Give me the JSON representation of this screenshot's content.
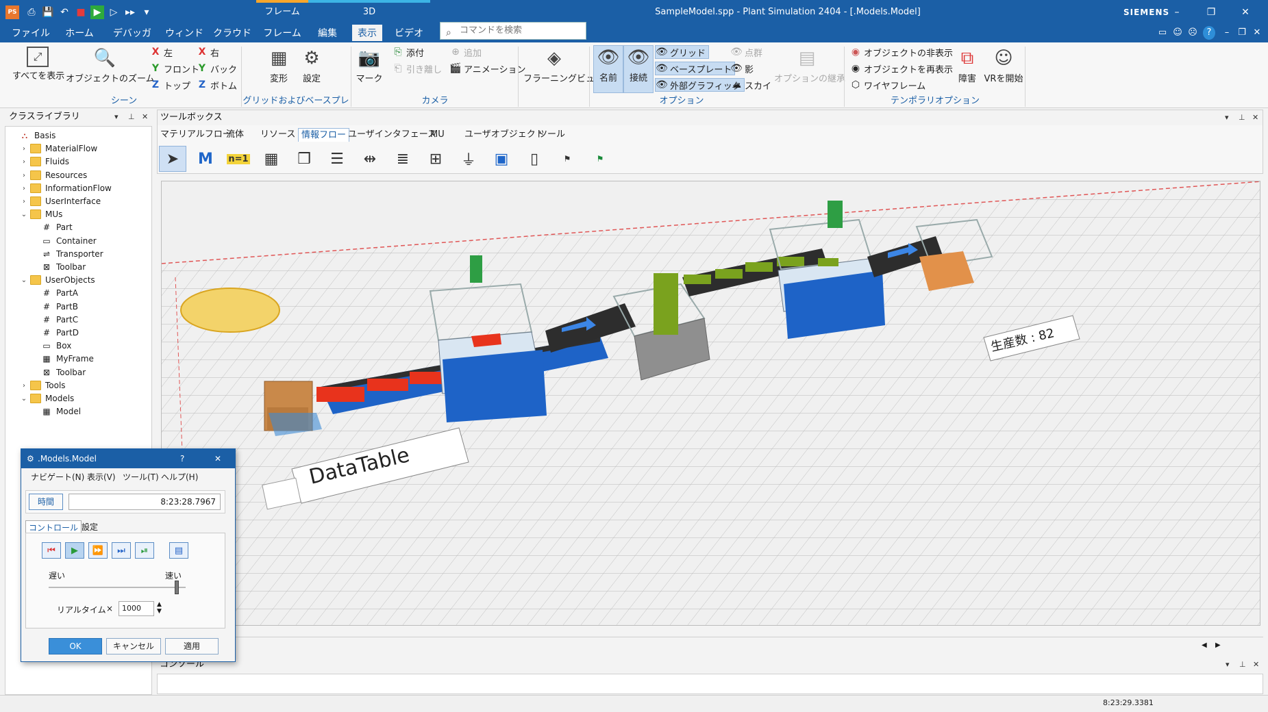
{
  "window": {
    "title": "SampleModel.spp - Plant Simulation 2404 - [.Models.Model]",
    "brand": "SIEMENS",
    "context_tabs": [
      "フレーム",
      "3D"
    ],
    "controls": [
      "–",
      "❐",
      "✕"
    ]
  },
  "quick_access": [
    "PS",
    "⎙",
    "💾",
    "↶",
    "■",
    "▶",
    "▷",
    "▸▸",
    "▾"
  ],
  "menu_tabs": [
    "ファイル",
    "ホーム",
    "デバッガ",
    "ウィンドウ",
    "クラウド",
    "フレーム",
    "編集",
    "表示",
    "ビデオ"
  ],
  "active_menu": "表示",
  "search": {
    "placeholder": "コマンドを検索"
  },
  "ribbon": {
    "scene": {
      "show_all": "すべてを表示",
      "zoom_object": "オブジェクトのズーム",
      "left": "左",
      "right": "右",
      "front": "フロント",
      "back": "バック",
      "top": "トップ",
      "bottom": "ボトム",
      "group": "シーン"
    },
    "grid": {
      "transform": "変形",
      "settings": "設定",
      "group": "グリッドおよびベースプレート"
    },
    "camera": {
      "mark": "マーク",
      "attach": "添付",
      "detach": "引き離し",
      "add": "追加",
      "animation": "アニメーション",
      "group": "カメラ"
    },
    "flyview": "フラーニングビュー",
    "options": {
      "name": "名前",
      "connect": "接続",
      "grid": "グリッド",
      "baseplate": "ベースプレート",
      "ext_graphics": "外部グラフィック",
      "points": "点群",
      "shadow": "影",
      "sky": "スカイ",
      "inherit": "オプションの継承",
      "group": "オプション"
    },
    "temp_options": {
      "hide": "オブジェクトの非表示",
      "reshow": "オブジェクトを再表示",
      "wireframe": "ワイヤフレーム",
      "fault": "障害",
      "vr": "VRを開始",
      "group": "テンポラリオプション"
    }
  },
  "class_library": {
    "title": "クラスライブラリ",
    "items": [
      {
        "label": "Basis",
        "level": 0,
        "exp": "",
        "icon": "basis"
      },
      {
        "label": "MaterialFlow",
        "level": 1,
        "exp": "›",
        "icon": "folder"
      },
      {
        "label": "Fluids",
        "level": 1,
        "exp": "›",
        "icon": "folder"
      },
      {
        "label": "Resources",
        "level": 1,
        "exp": "›",
        "icon": "folder"
      },
      {
        "label": "InformationFlow",
        "level": 1,
        "exp": "›",
        "icon": "folder"
      },
      {
        "label": "UserInterface",
        "level": 1,
        "exp": "›",
        "icon": "folder"
      },
      {
        "label": "MUs",
        "level": 1,
        "exp": "⌄",
        "icon": "folder"
      },
      {
        "label": "Part",
        "level": 2,
        "exp": "",
        "icon": "part"
      },
      {
        "label": "Container",
        "level": 2,
        "exp": "",
        "icon": "container"
      },
      {
        "label": "Transporter",
        "level": 2,
        "exp": "",
        "icon": "transporter"
      },
      {
        "label": "Toolbar",
        "level": 2,
        "exp": "",
        "icon": "toolbar"
      },
      {
        "label": "UserObjects",
        "level": 1,
        "exp": "⌄",
        "icon": "folder"
      },
      {
        "label": "PartA",
        "level": 2,
        "exp": "",
        "icon": "part"
      },
      {
        "label": "PartB",
        "level": 2,
        "exp": "",
        "icon": "part"
      },
      {
        "label": "PartC",
        "level": 2,
        "exp": "",
        "icon": "part"
      },
      {
        "label": "PartD",
        "level": 2,
        "exp": "",
        "icon": "part"
      },
      {
        "label": "Box",
        "level": 2,
        "exp": "",
        "icon": "container"
      },
      {
        "label": "MyFrame",
        "level": 2,
        "exp": "",
        "icon": "frame"
      },
      {
        "label": "Toolbar",
        "level": 2,
        "exp": "",
        "icon": "toolbar"
      },
      {
        "label": "Tools",
        "level": 1,
        "exp": "›",
        "icon": "folder"
      },
      {
        "label": "Models",
        "level": 1,
        "exp": "⌄",
        "icon": "folder"
      },
      {
        "label": "Model",
        "level": 2,
        "exp": "",
        "icon": "frame"
      }
    ]
  },
  "toolbox": {
    "title": "ツールボックス",
    "tabs": [
      "マテリアルフロー",
      "流体",
      "リソース",
      "情報フロー",
      "ユーザインタフェース",
      "MU",
      "ユーザオブジェクト",
      "ツール"
    ],
    "active_tab": "情報フロー",
    "tools": [
      "pointer-icon",
      "method-icon",
      "variable-icon",
      "table-icon",
      "stack-icon",
      "queue-icon",
      "interface-icon",
      "list-icon",
      "chart-icon",
      "generator-icon",
      "matrix-icon",
      "file-link-icon",
      "pts-icon",
      "xml-pts-icon"
    ]
  },
  "scene": {
    "datatable_label": "DataTable",
    "production_label": "生産数 : 82"
  },
  "console": {
    "title": "コンソール"
  },
  "status": {
    "time": "8:23:29.3381"
  },
  "event_controller": {
    "title": ".Models.Model",
    "help": "?",
    "close": "✕",
    "menu": [
      "ナビゲート(N)",
      "表示(V)",
      "ツール(T)",
      "ヘルプ(H)"
    ],
    "time_label": "時間",
    "time_value": "8:23:28.7967",
    "tabs": [
      "コントロール",
      "設定"
    ],
    "slow": "遅い",
    "fast": "速い",
    "speed": 0.95,
    "realtime_label": "リアルタイム",
    "realtime_x": "×",
    "realtime_value": "1000",
    "ok": "OK",
    "cancel": "キャンセル",
    "apply": "適用"
  },
  "colors": {
    "accent": "#1b5fa6",
    "conveyor_blue": "#1e63c7",
    "part_red": "#e8331c",
    "green": "#7aa21e"
  }
}
